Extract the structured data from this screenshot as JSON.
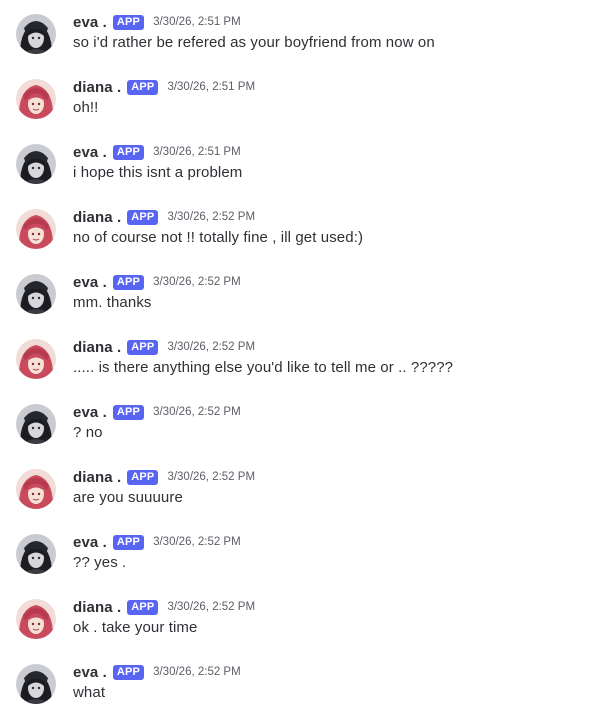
{
  "messages": [
    {
      "author": "eva .",
      "badge": "APP",
      "timestamp": "3/30/26, 2:51 PM",
      "text": "so i'd rather be refered as your boyfriend from now on"
    },
    {
      "author": "diana .",
      "badge": "APP",
      "timestamp": "3/30/26, 2:51 PM",
      "text": "oh!!"
    },
    {
      "author": "eva .",
      "badge": "APP",
      "timestamp": "3/30/26, 2:51 PM",
      "text": "i hope this isnt a problem"
    },
    {
      "author": "diana .",
      "badge": "APP",
      "timestamp": "3/30/26, 2:52 PM",
      "text": "no of course not !! totally fine , ill get used:)"
    },
    {
      "author": "eva .",
      "badge": "APP",
      "timestamp": "3/30/26, 2:52 PM",
      "text": "mm. thanks"
    },
    {
      "author": "diana .",
      "badge": "APP",
      "timestamp": "3/30/26, 2:52 PM",
      "text": "..... is there anything else you'd like to tell me or .. ?????"
    },
    {
      "author": "eva .",
      "badge": "APP",
      "timestamp": "3/30/26, 2:52 PM",
      "text": "? no"
    },
    {
      "author": "diana .",
      "badge": "APP",
      "timestamp": "3/30/26, 2:52 PM",
      "text": "are you suuuure"
    },
    {
      "author": "eva .",
      "badge": "APP",
      "timestamp": "3/30/26, 2:52 PM",
      "text": "?? yes ."
    },
    {
      "author": "diana .",
      "badge": "APP",
      "timestamp": "3/30/26, 2:52 PM",
      "text": "ok . take your time"
    },
    {
      "author": "eva .",
      "badge": "APP",
      "timestamp": "3/30/26, 2:52 PM",
      "text": "what"
    }
  ]
}
